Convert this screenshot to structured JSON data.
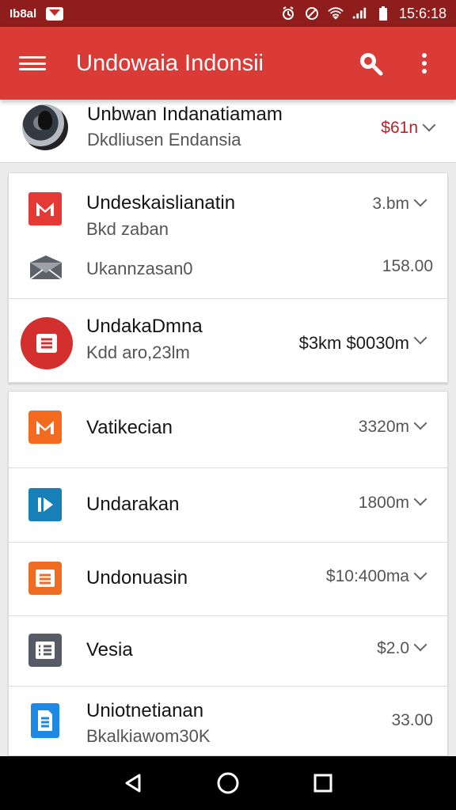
{
  "status_bar": {
    "carrier": "Ib8al",
    "time": "15:6:18"
  },
  "app_bar": {
    "title": "Undowaia Indonsii",
    "colors": {
      "app_bar": "#db3b36",
      "status_bar": "#8e1d1b"
    }
  },
  "rows": [
    {
      "title": "Unbwan Indanatiamam",
      "subtitle": "Dkdliusen Endansia",
      "amount": "$61n",
      "amount_color": "#b0252a",
      "icon": "avatar"
    },
    {
      "title": "Undeskaislianatin",
      "subtitle": "Bkd zaban",
      "amount": "3.bm",
      "icon": "gmail-icon"
    },
    {
      "title": "Ukannzasan0",
      "amount": "158.00",
      "icon": "mail-icon"
    },
    {
      "title": "UndakaDmna",
      "subtitle": "Kdd aro,23lm",
      "amount": "$3km $0030m",
      "icon": "document-icon"
    },
    {
      "title": "Vatikecian",
      "amount": "3320m",
      "icon": "messages-icon"
    },
    {
      "title": "Undarakan",
      "amount": "1800m",
      "icon": "play-icon"
    },
    {
      "title": "Undonuasin",
      "amount": "$10:400ma",
      "icon": "notes-icon"
    },
    {
      "title": "Vesia",
      "amount": "$2.0",
      "icon": "list-icon"
    },
    {
      "title": "Uniotnetianan",
      "subtitle": "Bkalkiawom30K",
      "amount": "33.00",
      "icon": "document-blue-icon"
    }
  ],
  "nav": {
    "back": "back-icon",
    "home": "home-icon",
    "recents": "recents-icon"
  }
}
